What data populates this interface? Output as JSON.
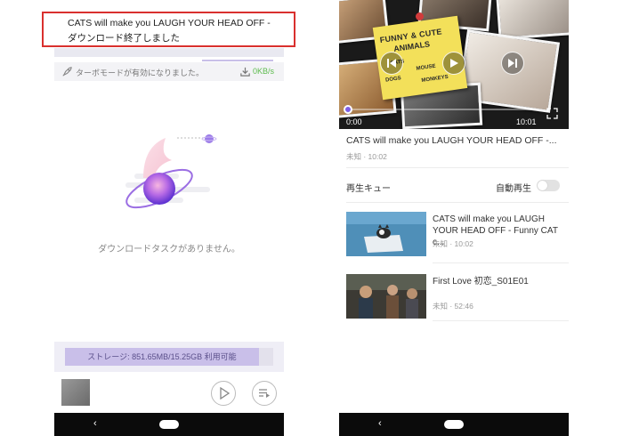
{
  "left": {
    "notification": {
      "title": "CATS will make you LAUGH YOUR HEAD OFF - Fun",
      "body": "ダウンロード終了しました"
    },
    "turbo": {
      "text": "ターボモードが有効になりました。",
      "speed": "0KB/s"
    },
    "empty_message": "ダウンロードタスクがありません。",
    "storage_text": "ストレージ: 851.65MB/15.25GB 利用可能",
    "nav": {
      "back": "‹"
    }
  },
  "right": {
    "video": {
      "sticky_title_1": "FUNNY & CUTE",
      "sticky_title_2": "ANIMALS",
      "sticky_words": [
        "CATS",
        "MOUSE",
        "DOGS",
        "MONKEYS"
      ],
      "current_time": "0:00",
      "duration": "10:01"
    },
    "now_playing": {
      "title": "CATS will make you LAUGH YOUR HEAD OFF -...",
      "meta": "未知 · 10:02"
    },
    "queue_label": "再生キュー",
    "autoplay_label": "自動再生",
    "queue": [
      {
        "title": "CATS will make you LAUGH YOUR HEAD OFF - Funny CAT c...",
        "meta": "未知 · 10:02"
      },
      {
        "title": "First Love 初恋_S01E01",
        "meta": "未知 · 52:46"
      }
    ],
    "nav": {
      "back": "‹"
    }
  },
  "colors": {
    "accent": "#7d5fe6",
    "storage_fill": "#c9bfe9",
    "highlight_box": "#d9302e",
    "speed_green": "#5dbb4e"
  }
}
